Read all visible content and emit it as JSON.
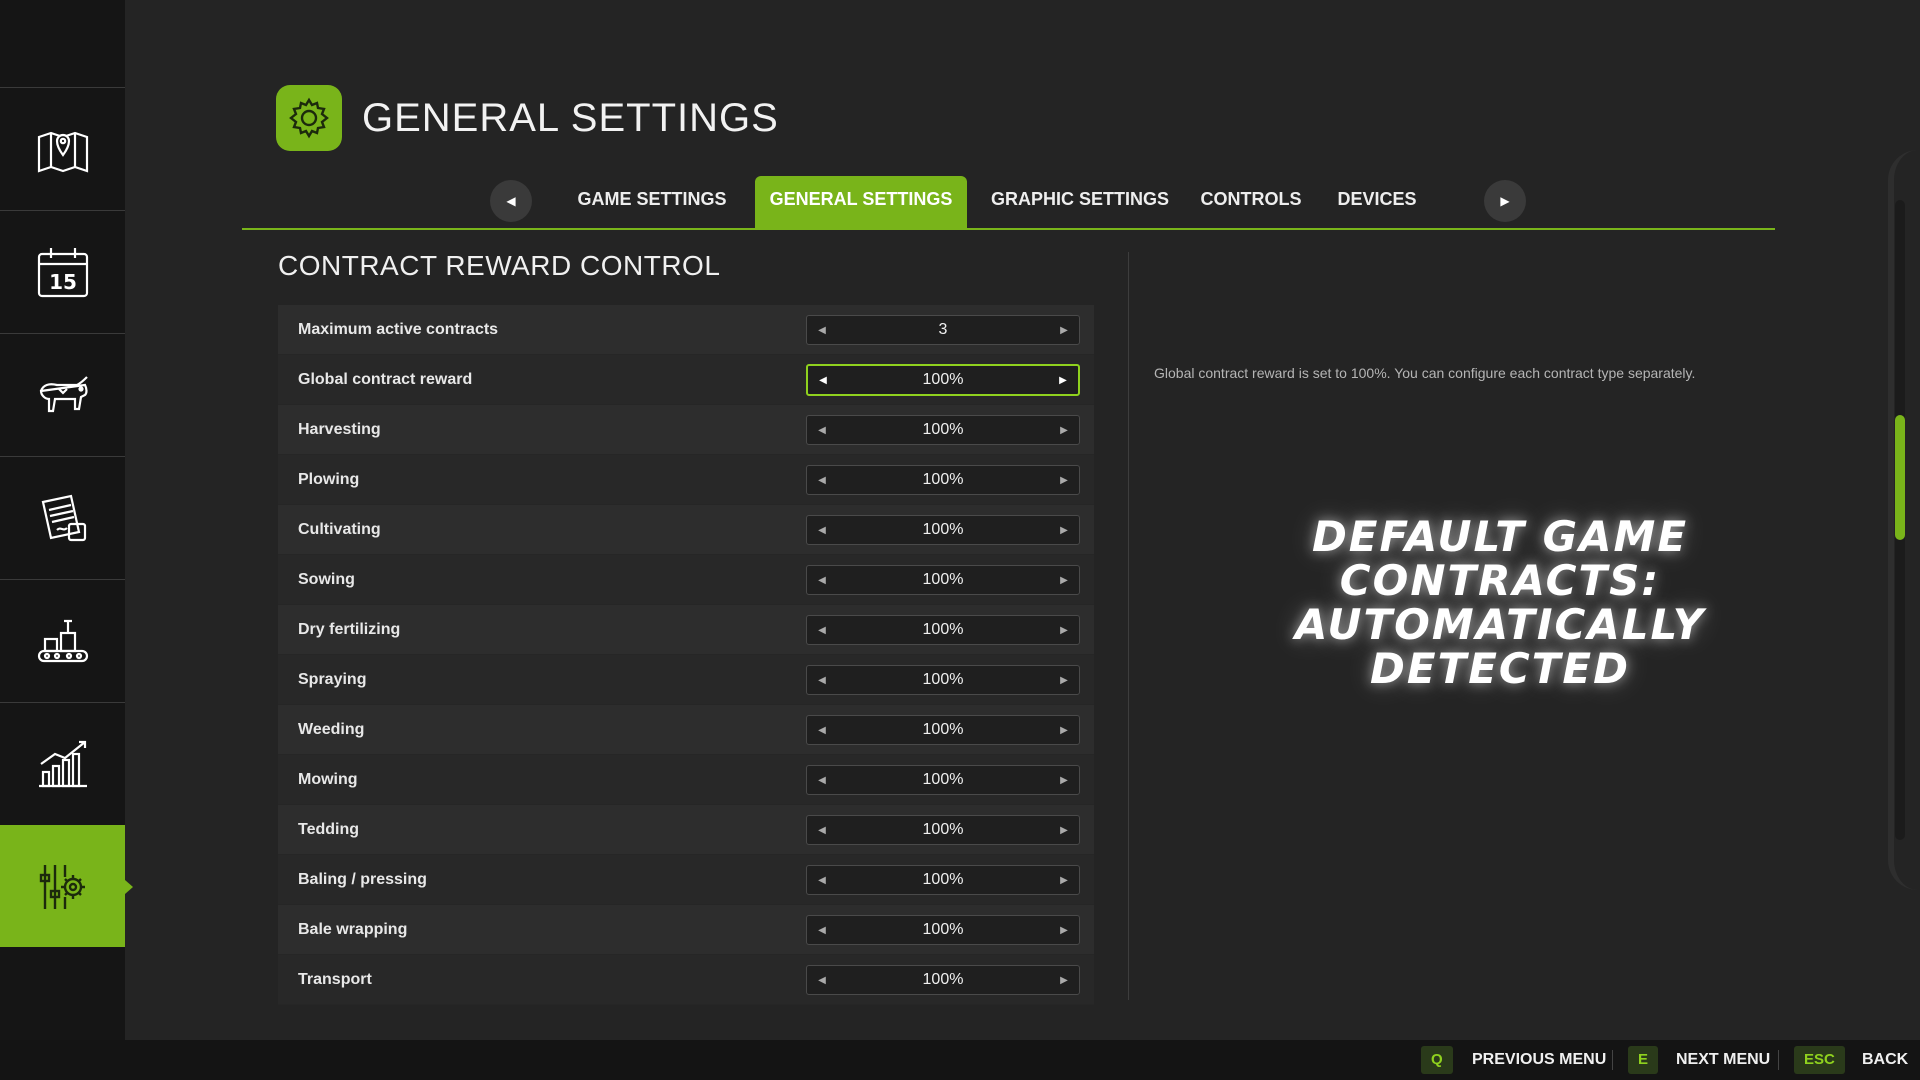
{
  "header": {
    "title": "GENERAL SETTINGS",
    "icon": "gear-icon"
  },
  "colors": {
    "accent": "#79b41a",
    "background": "#242424",
    "sidebar": "#151515"
  },
  "sidebar": {
    "items": [
      {
        "icon": "map-icon",
        "active": false
      },
      {
        "icon": "calendar-icon",
        "label": "15",
        "active": false
      },
      {
        "icon": "cow-icon",
        "active": false
      },
      {
        "icon": "contracts-icon",
        "active": false
      },
      {
        "icon": "production-icon",
        "active": false
      },
      {
        "icon": "statistics-icon",
        "active": false
      },
      {
        "icon": "settings-icon",
        "active": true
      }
    ]
  },
  "tabs": {
    "items": [
      {
        "label": "GAME SETTINGS",
        "active": false
      },
      {
        "label": "GENERAL SETTINGS",
        "active": true
      },
      {
        "label": "GRAPHIC SETTINGS",
        "active": false
      },
      {
        "label": "CONTROLS",
        "active": false
      },
      {
        "label": "DEVICES",
        "active": false
      }
    ]
  },
  "section": {
    "title": "CONTRACT REWARD CONTROL"
  },
  "settings": [
    {
      "label": "Maximum active contracts",
      "value": "3"
    },
    {
      "label": "Global contract reward",
      "value": "100%",
      "focused": true
    },
    {
      "label": "Harvesting",
      "value": "100%"
    },
    {
      "label": "Plowing",
      "value": "100%"
    },
    {
      "label": "Cultivating",
      "value": "100%"
    },
    {
      "label": "Sowing",
      "value": "100%"
    },
    {
      "label": "Dry fertilizing",
      "value": "100%"
    },
    {
      "label": "Spraying",
      "value": "100%"
    },
    {
      "label": "Weeding",
      "value": "100%"
    },
    {
      "label": "Mowing",
      "value": "100%"
    },
    {
      "label": "Tedding",
      "value": "100%"
    },
    {
      "label": "Baling / pressing",
      "value": "100%"
    },
    {
      "label": "Bale wrapping",
      "value": "100%"
    },
    {
      "label": "Transport",
      "value": "100%"
    }
  ],
  "help": {
    "text": "Global contract reward is set to 100%. You can configure each contract type separately."
  },
  "overlay": {
    "line1": "DEFAULT GAME",
    "line2": "CONTRACTS:",
    "line3": "AUTOMATICALLY DETECTED"
  },
  "footer": {
    "prev": {
      "key": "Q",
      "label": "PREVIOUS MENU"
    },
    "next": {
      "key": "E",
      "label": "NEXT MENU"
    },
    "back": {
      "key": "ESC",
      "label": "BACK"
    }
  }
}
